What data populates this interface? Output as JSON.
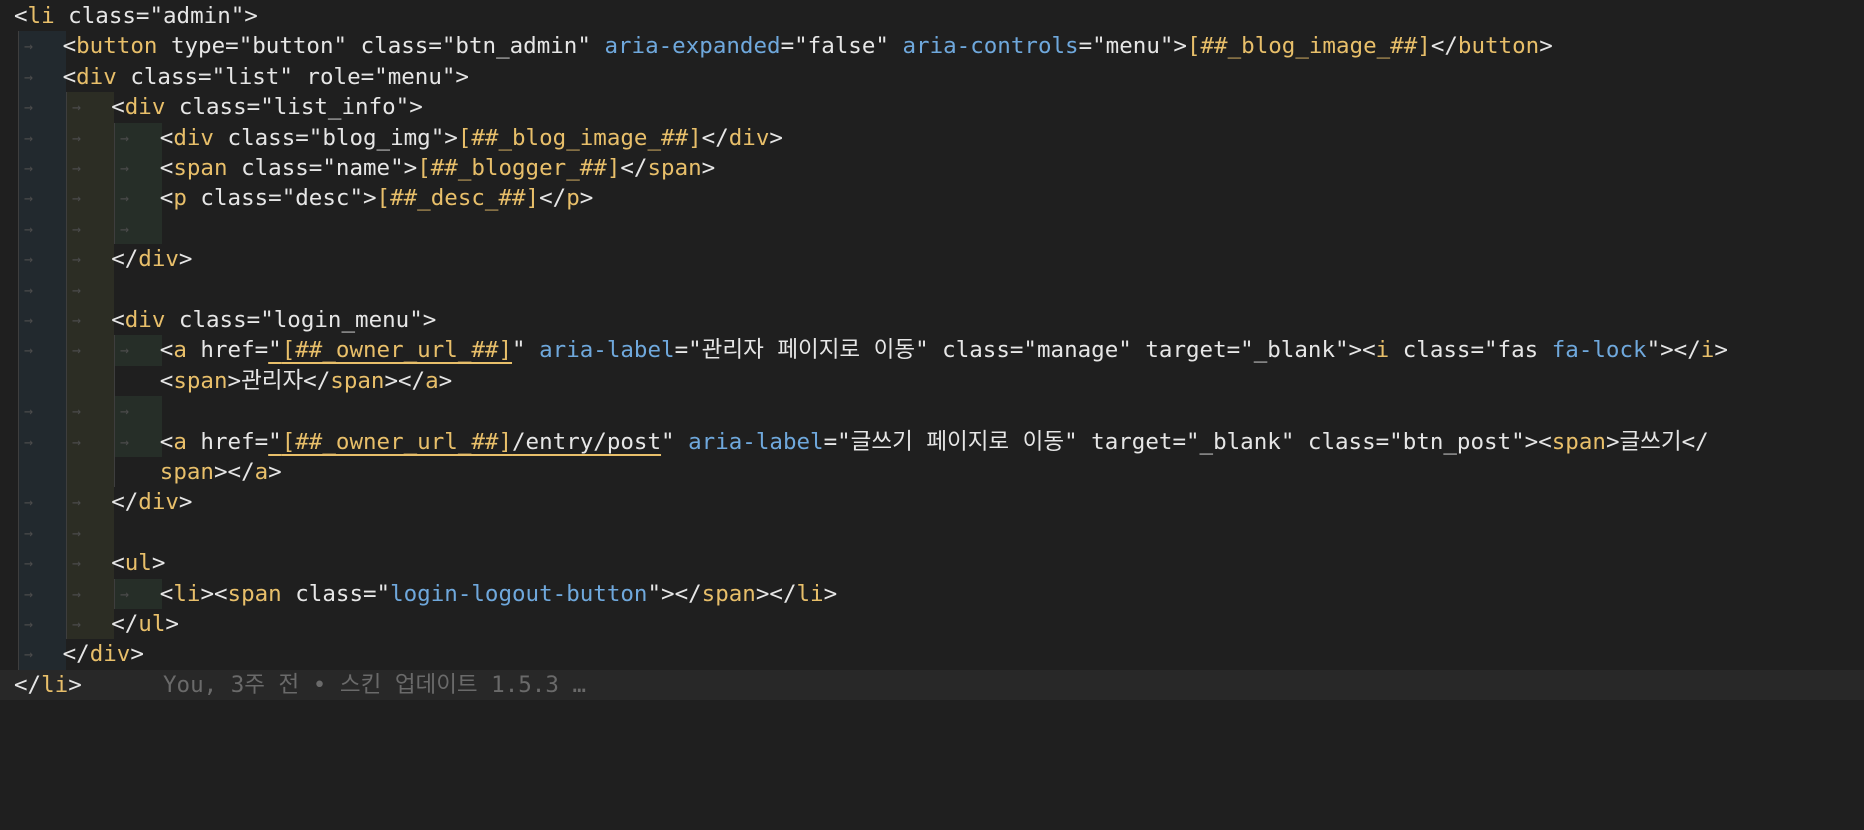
{
  "editor": {
    "colors": {
      "background": "#1f1f1f",
      "tag": "#e8bf6a",
      "aria_attr": "#6fa8dc",
      "text": "#e6e6e6",
      "blame": "#6a6a6a"
    },
    "indent_glyph": "→",
    "lines": [
      {
        "indent": 0,
        "tokens": [
          {
            "t": "p",
            "v": "<"
          },
          {
            "t": "tag",
            "v": "li"
          },
          {
            "t": "p",
            "v": " class=\"admin\">"
          }
        ]
      },
      {
        "indent": 1,
        "tokens": [
          {
            "t": "p",
            "v": "<"
          },
          {
            "t": "tag",
            "v": "button"
          },
          {
            "t": "p",
            "v": " type=\"button\" class=\"btn_admin\" "
          },
          {
            "t": "aria",
            "v": "aria-expanded"
          },
          {
            "t": "p",
            "v": "=\"false\" "
          },
          {
            "t": "aria",
            "v": "aria-controls"
          },
          {
            "t": "p",
            "v": "=\"menu\">"
          },
          {
            "t": "ph",
            "v": "[##_blog_image_##]"
          },
          {
            "t": "p",
            "v": "</"
          },
          {
            "t": "tag",
            "v": "button"
          },
          {
            "t": "p",
            "v": ">"
          }
        ]
      },
      {
        "indent": 1,
        "tokens": [
          {
            "t": "p",
            "v": "<"
          },
          {
            "t": "tag",
            "v": "div"
          },
          {
            "t": "p",
            "v": " class=\"list\" role=\"menu\">"
          }
        ]
      },
      {
        "indent": 2,
        "tokens": [
          {
            "t": "p",
            "v": "<"
          },
          {
            "t": "tag",
            "v": "div"
          },
          {
            "t": "p",
            "v": " class=\"list_info\">"
          }
        ]
      },
      {
        "indent": 3,
        "tokens": [
          {
            "t": "p",
            "v": "<"
          },
          {
            "t": "tag",
            "v": "div"
          },
          {
            "t": "p",
            "v": " class=\"blog_img\">"
          },
          {
            "t": "ph",
            "v": "[##_blog_image_##]"
          },
          {
            "t": "p",
            "v": "</"
          },
          {
            "t": "tag",
            "v": "div"
          },
          {
            "t": "p",
            "v": ">"
          }
        ]
      },
      {
        "indent": 3,
        "tokens": [
          {
            "t": "p",
            "v": "<"
          },
          {
            "t": "tag",
            "v": "span"
          },
          {
            "t": "p",
            "v": " class=\"name\">"
          },
          {
            "t": "ph",
            "v": "[##_blogger_##]"
          },
          {
            "t": "p",
            "v": "</"
          },
          {
            "t": "tag",
            "v": "span"
          },
          {
            "t": "p",
            "v": ">"
          }
        ]
      },
      {
        "indent": 3,
        "tokens": [
          {
            "t": "p",
            "v": "<"
          },
          {
            "t": "tag",
            "v": "p"
          },
          {
            "t": "p",
            "v": " class=\"desc\">"
          },
          {
            "t": "ph",
            "v": "[##_desc_##]"
          },
          {
            "t": "p",
            "v": "</"
          },
          {
            "t": "tag",
            "v": "p"
          },
          {
            "t": "p",
            "v": ">"
          }
        ]
      },
      {
        "indent": 3,
        "tokens": []
      },
      {
        "indent": 2,
        "tokens": [
          {
            "t": "p",
            "v": "</"
          },
          {
            "t": "tag",
            "v": "div"
          },
          {
            "t": "p",
            "v": ">"
          }
        ]
      },
      {
        "indent": 2,
        "tokens": []
      },
      {
        "indent": 2,
        "tokens": [
          {
            "t": "p",
            "v": "<"
          },
          {
            "t": "tag",
            "v": "div"
          },
          {
            "t": "p",
            "v": " class=\"login_menu\">"
          }
        ]
      },
      {
        "indent": 3,
        "tokens": [
          {
            "t": "p",
            "v": "<"
          },
          {
            "t": "tag",
            "v": "a"
          },
          {
            "t": "p",
            "v": " href="
          },
          {
            "t": "ul",
            "v": "\""
          },
          {
            "t": "ulph",
            "v": "[##_owner_url_##]"
          },
          {
            "t": "p",
            "v": "\" "
          },
          {
            "t": "aria",
            "v": "aria-label"
          },
          {
            "t": "p",
            "v": "=\"관리자 페이지로 이동\" class=\"manage\" target=\"_blank\"><"
          },
          {
            "t": "tag",
            "v": "i"
          },
          {
            "t": "p",
            "v": " class=\"fas "
          },
          {
            "t": "aria",
            "v": "fa-lock"
          },
          {
            "t": "p",
            "v": "\"></"
          },
          {
            "t": "tag",
            "v": "i"
          },
          {
            "t": "p",
            "v": ">"
          }
        ]
      },
      {
        "indent": 3,
        "wrap": true,
        "tokens": [
          {
            "t": "p",
            "v": "<"
          },
          {
            "t": "tag",
            "v": "span"
          },
          {
            "t": "p",
            "v": ">관리자</"
          },
          {
            "t": "tag",
            "v": "span"
          },
          {
            "t": "p",
            "v": "></"
          },
          {
            "t": "tag",
            "v": "a"
          },
          {
            "t": "p",
            "v": ">"
          }
        ]
      },
      {
        "indent": 3,
        "tokens": []
      },
      {
        "indent": 3,
        "tokens": [
          {
            "t": "p",
            "v": "<"
          },
          {
            "t": "tag",
            "v": "a"
          },
          {
            "t": "p",
            "v": " href="
          },
          {
            "t": "ul",
            "v": "\""
          },
          {
            "t": "ulph",
            "v": "[##_owner_url_##]"
          },
          {
            "t": "ul",
            "v": "/entry/post"
          },
          {
            "t": "p",
            "v": "\" "
          },
          {
            "t": "aria",
            "v": "aria-label"
          },
          {
            "t": "p",
            "v": "=\"글쓰기 페이지로 이동\" target=\"_blank\" class=\"btn_post\"><"
          },
          {
            "t": "tag",
            "v": "span"
          },
          {
            "t": "p",
            "v": ">글쓰기</"
          }
        ]
      },
      {
        "indent": 3,
        "wrap": true,
        "tokens": [
          {
            "t": "tag",
            "v": "span"
          },
          {
            "t": "p",
            "v": "></"
          },
          {
            "t": "tag",
            "v": "a"
          },
          {
            "t": "p",
            "v": ">"
          }
        ]
      },
      {
        "indent": 2,
        "tokens": [
          {
            "t": "p",
            "v": "</"
          },
          {
            "t": "tag",
            "v": "div"
          },
          {
            "t": "p",
            "v": ">"
          }
        ]
      },
      {
        "indent": 2,
        "tokens": []
      },
      {
        "indent": 2,
        "tokens": [
          {
            "t": "p",
            "v": "<"
          },
          {
            "t": "tag",
            "v": "ul"
          },
          {
            "t": "p",
            "v": ">"
          }
        ]
      },
      {
        "indent": 3,
        "tokens": [
          {
            "t": "p",
            "v": "<"
          },
          {
            "t": "tag",
            "v": "li"
          },
          {
            "t": "p",
            "v": "><"
          },
          {
            "t": "tag",
            "v": "span"
          },
          {
            "t": "p",
            "v": " class=\""
          },
          {
            "t": "aria",
            "v": "login-logout-button"
          },
          {
            "t": "p",
            "v": "\"></"
          },
          {
            "t": "tag",
            "v": "span"
          },
          {
            "t": "p",
            "v": "></"
          },
          {
            "t": "tag",
            "v": "li"
          },
          {
            "t": "p",
            "v": ">"
          }
        ]
      },
      {
        "indent": 2,
        "tokens": [
          {
            "t": "p",
            "v": "</"
          },
          {
            "t": "tag",
            "v": "ul"
          },
          {
            "t": "p",
            "v": ">"
          }
        ]
      },
      {
        "indent": 1,
        "tokens": [
          {
            "t": "p",
            "v": "</"
          },
          {
            "t": "tag",
            "v": "div"
          },
          {
            "t": "p",
            "v": ">"
          }
        ]
      },
      {
        "indent": 0,
        "current": true,
        "blame": "You, 3주 전 • 스킨 업데이트 1.5.3 …",
        "tokens": [
          {
            "t": "p",
            "v": "</"
          },
          {
            "t": "tag",
            "v": "li"
          },
          {
            "t": "p",
            "v": ">"
          }
        ]
      }
    ]
  }
}
